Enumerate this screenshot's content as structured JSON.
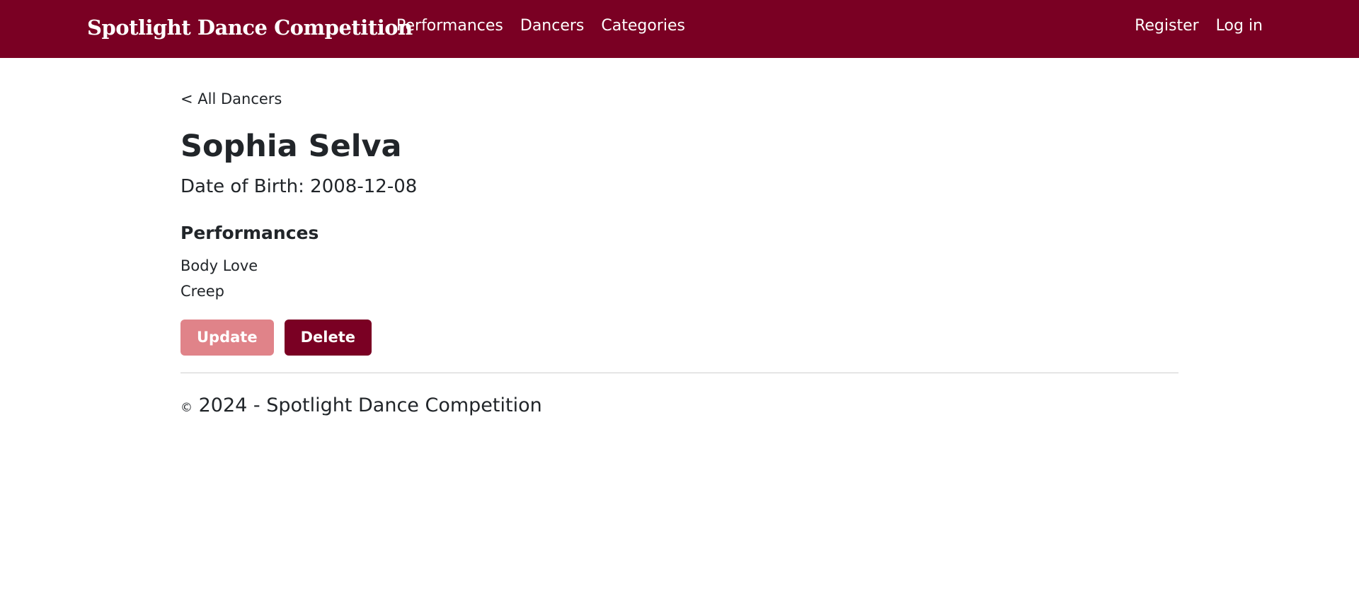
{
  "navbar": {
    "brand": "Spotlight Dance Competition",
    "links": [
      "Performances",
      "Dancers",
      "Categories"
    ],
    "right_links": [
      "Register",
      "Log in"
    ],
    "background_color": "#7a0023"
  },
  "main": {
    "back_link": "< All Dancers",
    "dancer_name": "Sophia Selva",
    "dob": "Date of Birth: 2008-12-08",
    "performances_heading": "Performances",
    "performances": [
      "Body Love",
      "Creep"
    ],
    "buttons": {
      "update": "Update",
      "delete": "Delete",
      "update_color": "#e08389",
      "delete_color": "#7a0023"
    }
  },
  "footer": {
    "copyright_symbol": "©",
    "text": " 2024 - Spotlight Dance Competition"
  }
}
